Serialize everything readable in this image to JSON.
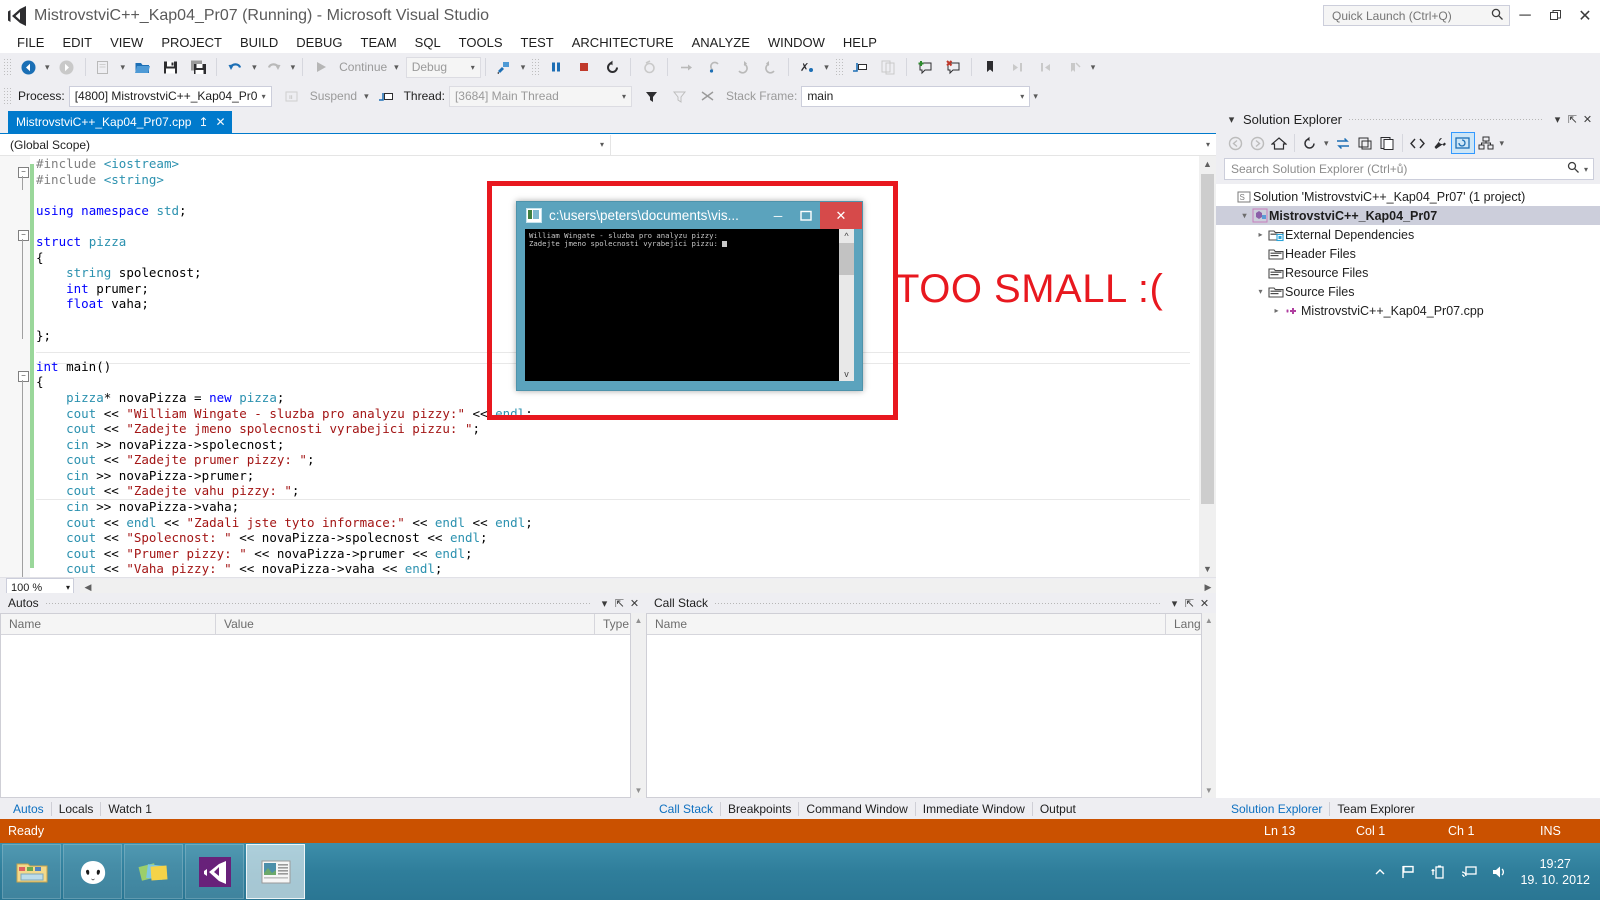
{
  "window": {
    "title": "MistrovstviC++_Kap04_Pr07 (Running) - Microsoft Visual Studio",
    "minimize": "─",
    "restore": "❐",
    "close": "✕"
  },
  "quick_launch": {
    "placeholder": "Quick Launch (Ctrl+Q)",
    "value": ""
  },
  "menu": [
    "FILE",
    "EDIT",
    "VIEW",
    "PROJECT",
    "BUILD",
    "DEBUG",
    "TEAM",
    "SQL",
    "TOOLS",
    "TEST",
    "ARCHITECTURE",
    "ANALYZE",
    "WINDOW",
    "HELP"
  ],
  "toolbar": {
    "continue_label": "Continue",
    "config_label": "Debug",
    "icons": [
      "navigate-back-icon",
      "navigate-forward-icon",
      "new-project-icon",
      "open-file-icon",
      "save-icon",
      "save-all-icon",
      "undo-icon",
      "redo-icon",
      "play-icon",
      "attach-process-icon",
      "pause-icon",
      "stop-icon",
      "restart-icon",
      "break-all-icon",
      "step-over-icon",
      "step-into-icon",
      "step-out-icon",
      "step-back-icon",
      "hex-icon",
      "threads-icon",
      "new-window-icon",
      "comment-icon",
      "uncomment-icon",
      "bookmark-icon",
      "prev-bookmark-icon",
      "next-bookmark-icon",
      "clear-bookmarks-icon"
    ]
  },
  "debug_bar": {
    "process_label": "Process:",
    "process_value": "[4800] MistrovstviC++_Kap04_Pr07",
    "suspend_label": "Suspend",
    "thread_label": "Thread:",
    "thread_value": "[3684] Main Thread",
    "stack_frame_label": "Stack Frame:",
    "stack_frame_value": "main"
  },
  "document_tab": {
    "label": "MistrovstviC++_Kap04_Pr07.cpp",
    "pin": "↥",
    "close": "✕"
  },
  "scope_bar": {
    "left": "(Global Scope)",
    "right": ""
  },
  "editor": {
    "zoom": "100 %",
    "lines": [
      {
        "t": "pp",
        "s": "#include ",
        "tail": "<iostream>",
        "tailc": "ty"
      },
      {
        "t": "pp",
        "s": "#include ",
        "tail": "<string>",
        "tailc": "ty"
      },
      {
        "t": "blank",
        "s": ""
      },
      {
        "t": "raw",
        "s": "using namespace std;"
      },
      {
        "t": "blank",
        "s": ""
      },
      {
        "t": "raw",
        "s": "struct pizza"
      },
      {
        "t": "raw",
        "s": "{"
      },
      {
        "t": "raw",
        "s": "    string spolecnost;"
      },
      {
        "t": "raw",
        "s": "    int prumer;"
      },
      {
        "t": "raw",
        "s": "    float vaha;"
      },
      {
        "t": "blank",
        "s": ""
      },
      {
        "t": "raw",
        "s": "};"
      },
      {
        "t": "blank",
        "s": ""
      },
      {
        "t": "raw",
        "s": "int main()"
      },
      {
        "t": "raw",
        "s": "{"
      },
      {
        "t": "raw",
        "s": "    pizza* novaPizza = new pizza;"
      },
      {
        "t": "raw",
        "s": "    cout << \"William Wingate - sluzba pro analyzu pizzy:\" << endl;"
      },
      {
        "t": "raw",
        "s": "    cout << \"Zadejte jmeno spolecnosti vyrabejici pizzu: \";"
      },
      {
        "t": "raw",
        "s": "    cin >> novaPizza->spolecnost;"
      },
      {
        "t": "raw",
        "s": "    cout << \"Zadejte prumer pizzy: \";"
      },
      {
        "t": "raw",
        "s": "    cin >> novaPizza->prumer;"
      },
      {
        "t": "raw",
        "s": "    cout << \"Zadejte vahu pizzy: \";"
      },
      {
        "t": "raw",
        "s": "    cin >> novaPizza->vaha;"
      },
      {
        "t": "raw",
        "s": "    cout << endl << \"Zadali jste tyto informace:\" << endl << endl;"
      },
      {
        "t": "raw",
        "s": "    cout << \"Spolecnost: \" << novaPizza->spolecnost << endl;"
      },
      {
        "t": "raw",
        "s": "    cout << \"Prumer pizzy: \" << novaPizza->prumer << endl;"
      },
      {
        "t": "raw",
        "s": "    cout << \"Vaha pizzy: \" << novaPizza->vaha << endl;"
      }
    ]
  },
  "autos_panel": {
    "title": "Autos",
    "columns": [
      "Name",
      "Value",
      "Type"
    ],
    "rows": [],
    "tabs": [
      {
        "label": "Autos",
        "active": true
      },
      {
        "label": "Locals",
        "active": false
      },
      {
        "label": "Watch 1",
        "active": false
      }
    ]
  },
  "callstack_panel": {
    "title": "Call Stack",
    "columns": [
      "Name",
      "Lang"
    ],
    "rows": [],
    "tabs": [
      {
        "label": "Call Stack",
        "active": true
      },
      {
        "label": "Breakpoints",
        "active": false
      },
      {
        "label": "Command Window",
        "active": false
      },
      {
        "label": "Immediate Window",
        "active": false
      },
      {
        "label": "Output",
        "active": false
      }
    ]
  },
  "solution_explorer": {
    "title": "Solution Explorer",
    "search_placeholder": "Search Solution Explorer (Ctrl+ů)",
    "toolbar_icons": [
      "back-icon",
      "forward-icon",
      "home-icon",
      "sync-icon",
      "refresh-icon",
      "collapse-all-icon",
      "show-all-files-icon",
      "view-code-icon",
      "properties-icon",
      "preview-selected-items-icon",
      "class-view-icon",
      "overflow-chevron-icon"
    ],
    "tree": [
      {
        "indent": 0,
        "arrow": "",
        "icon": "solution-icon",
        "label": "Solution 'MistrovstviC++_Kap04_Pr07' (1 project)",
        "selected": false
      },
      {
        "indent": 1,
        "arrow": "▾",
        "icon": "cpp-project-icon",
        "label": "MistrovstviC++_Kap04_Pr07",
        "selected": true
      },
      {
        "indent": 2,
        "arrow": "▸",
        "icon": "folder-ext-icon",
        "label": "External Dependencies",
        "selected": false
      },
      {
        "indent": 2,
        "arrow": "",
        "icon": "folder-icon",
        "label": "Header Files",
        "selected": false
      },
      {
        "indent": 2,
        "arrow": "",
        "icon": "folder-icon",
        "label": "Resource Files",
        "selected": false
      },
      {
        "indent": 2,
        "arrow": "▾",
        "icon": "folder-icon",
        "label": "Source Files",
        "selected": false
      },
      {
        "indent": 3,
        "arrow": "▸",
        "icon": "cpp-file-icon",
        "label": "MistrovstviC++_Kap04_Pr07.cpp",
        "selected": false
      }
    ],
    "tabs": [
      {
        "label": "Solution Explorer",
        "active": true
      },
      {
        "label": "Team Explorer",
        "active": false
      }
    ]
  },
  "status_bar": {
    "ready": "Ready",
    "line": "Ln 13",
    "col": "Col 1",
    "ch": "Ch 1",
    "ins": "INS",
    "accent": "#ca5100"
  },
  "console_window": {
    "title": "c:\\users\\peters\\documents\\vis...",
    "minimize": "─",
    "maximize": "☐",
    "close": "✕",
    "output": "William Wingate - sluzba pro analyzu pizzy:\nZadejte jmeno spolecnosti vyrabejici pizzu: "
  },
  "annotation": {
    "text": "TOO SMALL :(",
    "color": "#e8181f"
  },
  "taskbar": {
    "items": [
      {
        "name": "file-explorer-icon",
        "label": "File Explorer"
      },
      {
        "name": "foobar-icon",
        "label": "Foobar2000"
      },
      {
        "name": "picasa-icon",
        "label": "Picasa"
      },
      {
        "name": "visual-studio-icon",
        "label": "Visual Studio"
      },
      {
        "name": "console-window-icon",
        "label": "Console window"
      }
    ],
    "tray": [
      "show-hidden-icons",
      "flag-action-center-icon",
      "battery-icon",
      "network-icon",
      "volume-icon"
    ],
    "time": "19:27",
    "date": "19. 10. 2012"
  }
}
